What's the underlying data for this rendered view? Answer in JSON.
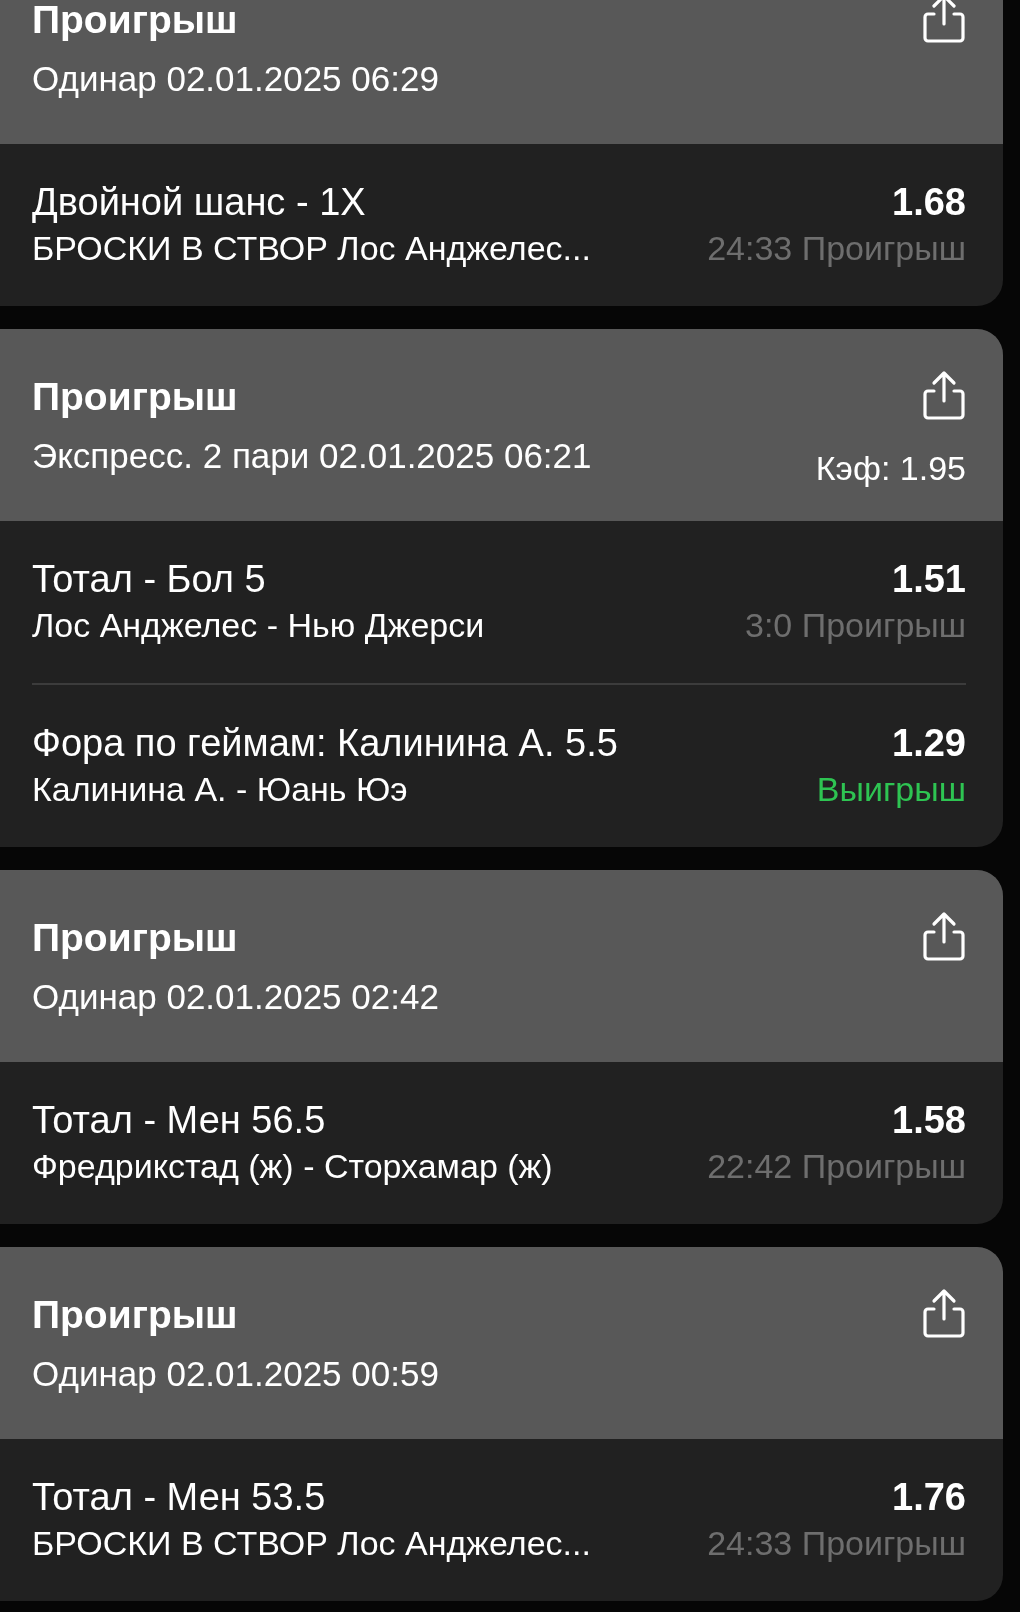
{
  "bets": [
    {
      "title": "Проигрыш",
      "subtitle": "Одинар 02.01.2025 06:29",
      "legs": [
        {
          "market": "Двойной шанс - 1X",
          "event": "БРОСКИ В СТВОР Лос Анджелес...",
          "odds": "1.68",
          "status": "24:33 Проигрыш",
          "kind": "loss"
        }
      ]
    },
    {
      "title": "Проигрыш",
      "subtitle": "Экспресс. 2 пари 02.01.2025 06:21",
      "coef": "Кэф: 1.95",
      "legs": [
        {
          "market": "Тотал - Бол 5",
          "event": "Лос Анджелес - Нью Джерси",
          "odds": "1.51",
          "status": "3:0 Проигрыш",
          "kind": "loss"
        },
        {
          "market": "Фора по геймам: Калинина А. 5.5",
          "event": "Калинина А. - Юань Юэ",
          "odds": "1.29",
          "status": "Выигрыш",
          "kind": "win"
        }
      ]
    },
    {
      "title": "Проигрыш",
      "subtitle": "Одинар 02.01.2025 02:42",
      "legs": [
        {
          "market": "Тотал - Мен 56.5",
          "event": "Фредрикстад (ж) - Сторхамар (ж)",
          "odds": "1.58",
          "status": "22:42 Проигрыш",
          "kind": "loss"
        }
      ]
    },
    {
      "title": "Проигрыш",
      "subtitle": "Одинар 02.01.2025 00:59",
      "legs": [
        {
          "market": "Тотал - Мен 53.5",
          "event": "БРОСКИ В СТВОР Лос Анджелес...",
          "odds": "1.76",
          "status": "24:33 Проигрыш",
          "kind": "loss"
        }
      ]
    }
  ]
}
